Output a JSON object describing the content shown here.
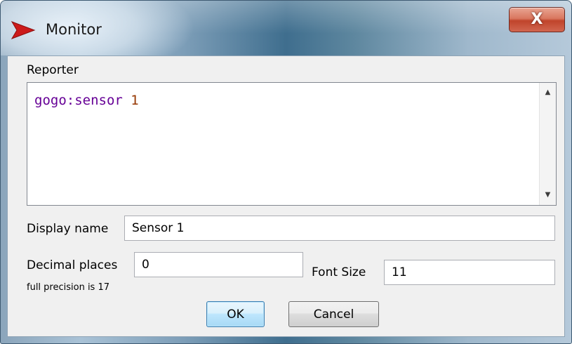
{
  "window": {
    "title": "Monitor",
    "close_glyph": "X"
  },
  "reporter": {
    "label": "Reporter",
    "code_primitive": "gogo:sensor",
    "code_argument": "1",
    "scroll_up_glyph": "▲",
    "scroll_down_glyph": "▼"
  },
  "display_name": {
    "label": "Display name",
    "value": "Sensor 1"
  },
  "decimal_places": {
    "label": "Decimal places",
    "value": "0",
    "hint": "full precision is 17"
  },
  "font_size": {
    "label": "Font Size",
    "value": "11"
  },
  "buttons": {
    "ok_label": "OK",
    "cancel_label": "Cancel"
  },
  "colors": {
    "code_primitive": "#660096",
    "code_number": "#963700",
    "app_icon": "#cc1a1a",
    "close_button": "#c0442b"
  },
  "icons": {
    "app": "netlogo-red-arrow-icon",
    "close": "close-icon",
    "scroll_up": "scroll-up-arrow-icon",
    "scroll_down": "scroll-down-arrow-icon"
  }
}
